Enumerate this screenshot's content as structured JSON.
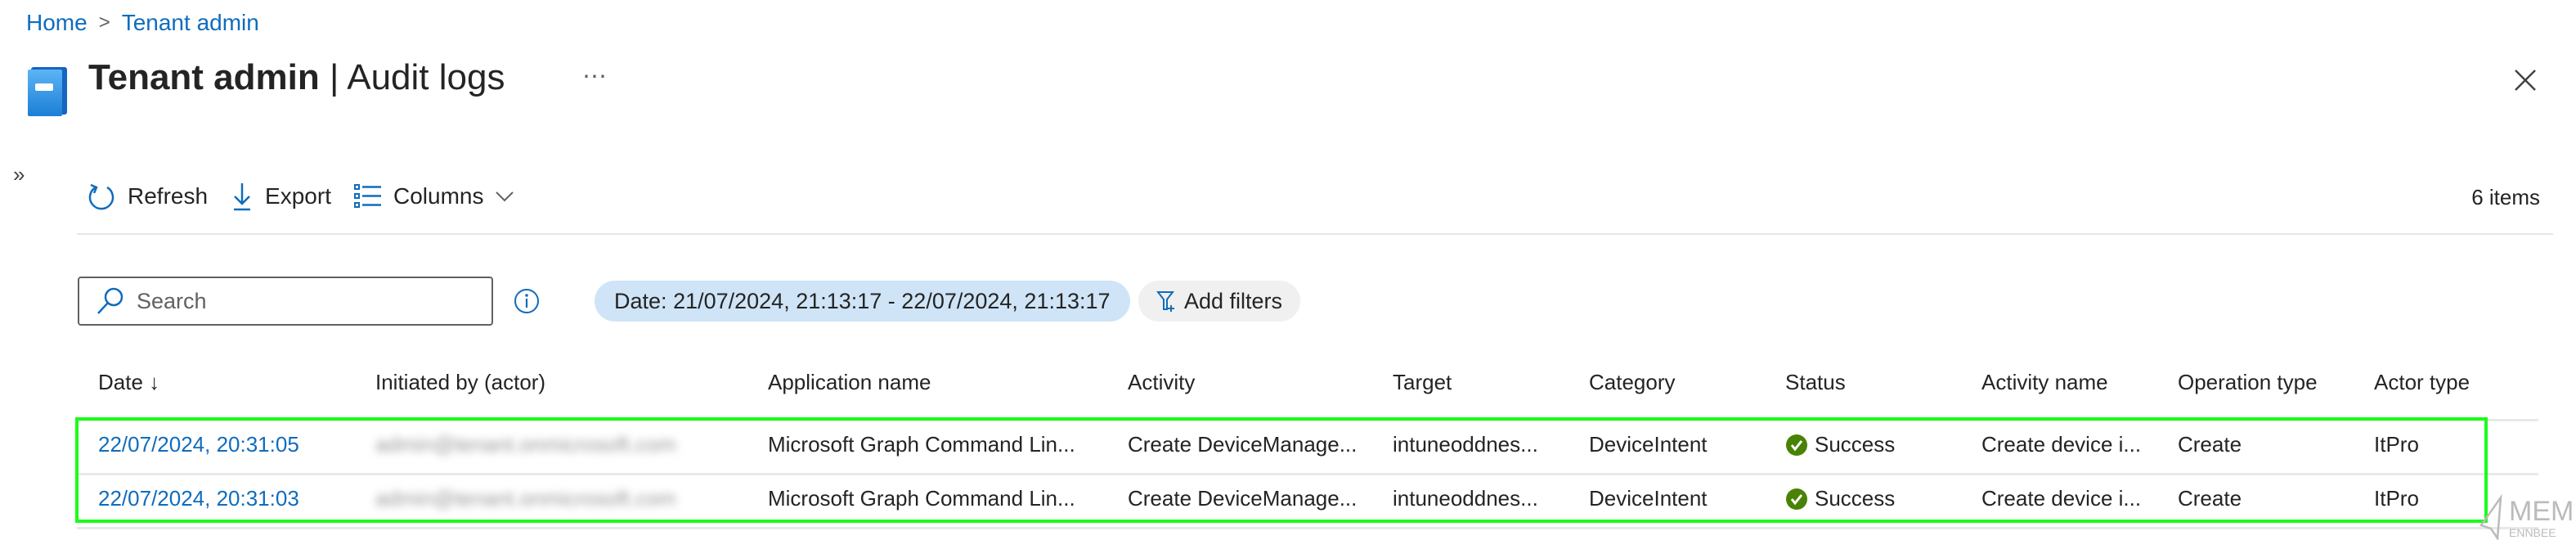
{
  "breadcrumb": {
    "items": [
      "Home",
      "Tenant admin"
    ],
    "separator": ">"
  },
  "header": {
    "title_bold": "Tenant admin",
    "title_sep": " | ",
    "title_rest": "Audit logs",
    "more_label": "⋯",
    "icon": "book-icon",
    "close_icon": "close-icon"
  },
  "sidebar_toggle": "»",
  "toolbar": {
    "refresh_label": "Refresh",
    "export_label": "Export",
    "columns_label": "Columns",
    "items_count": "6 items"
  },
  "filters": {
    "search_placeholder": "Search",
    "date_label": "Date:",
    "date_value": "21/07/2024, 21:13:17 - 22/07/2024, 21:13:17",
    "add_filters_label": "Add filters"
  },
  "table": {
    "columns": [
      "Date ↓",
      "Initiated by (actor)",
      "Application name",
      "Activity",
      "Target",
      "Category",
      "Status",
      "Activity name",
      "Operation type",
      "Actor type"
    ],
    "rows": [
      {
        "date": "22/07/2024, 20:31:05",
        "actor": "admin@tenant.onmicrosoft.com",
        "application": "Microsoft Graph Command Lin...",
        "activity": "Create DeviceManage...",
        "target": "intuneoddnes...",
        "category": "DeviceIntent",
        "status": "Success",
        "activity_name": "Create device i...",
        "operation_type": "Create",
        "actor_type": "ItPro"
      },
      {
        "date": "22/07/2024, 20:31:03",
        "actor": "admin@tenant.onmicrosoft.com",
        "application": "Microsoft Graph Command Lin...",
        "activity": "Create DeviceManage...",
        "target": "intuneoddnes...",
        "category": "DeviceIntent",
        "status": "Success",
        "activity_name": "Create device i...",
        "operation_type": "Create",
        "actor_type": "ItPro"
      }
    ]
  },
  "colors": {
    "accent": "#0f6cbd",
    "success": "#498205",
    "highlight": "#1bfc1b",
    "pill": "#cfe4f7"
  },
  "watermark": {
    "line1": "MEM",
    "line2": "ENNBEE"
  }
}
